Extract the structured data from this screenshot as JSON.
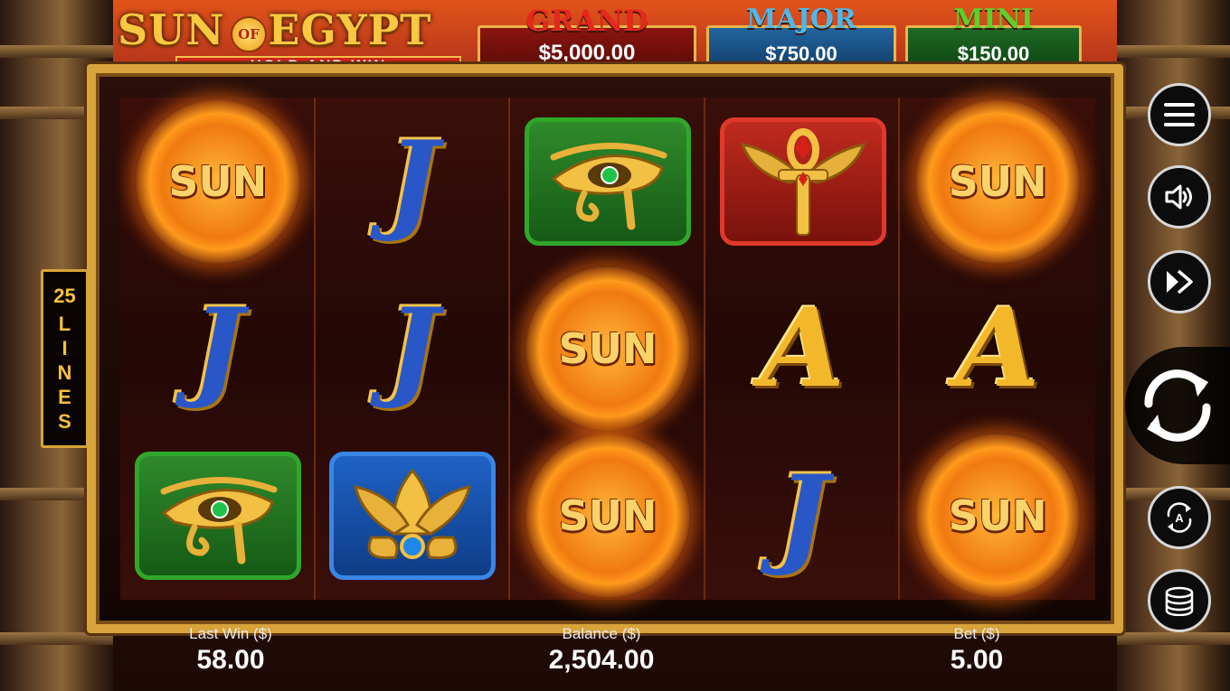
{
  "game": {
    "title": "SUN OF EGYPT",
    "title_main": "SUN",
    "title_of": "OF",
    "title_egypt": "EGYPT",
    "subtitle": "HOLD AND WIN"
  },
  "jackpots": [
    {
      "label": "GRAND",
      "value": "$5,000.00",
      "color": "#e6281c"
    },
    {
      "label": "MAJOR",
      "value": "$750.00",
      "color": "#52b7e6"
    },
    {
      "label": "MINI",
      "value": "$150.00",
      "color": "#5fd02a"
    }
  ],
  "paylines": {
    "count": "25",
    "word": "LINES"
  },
  "reels": [
    [
      "sun",
      "j",
      "eye"
    ],
    [
      "j",
      "j",
      "lotus"
    ],
    [
      "eye",
      "sun",
      "sun"
    ],
    [
      "ankh",
      "a",
      "j"
    ],
    [
      "sun",
      "a",
      "sun"
    ]
  ],
  "symbol_text": {
    "sun": "SUN",
    "j": "J",
    "a": "A"
  },
  "side_buttons": [
    "menu-icon",
    "sound-icon",
    "fast-forward-icon",
    "spin-icon",
    "autoplay-icon",
    "coins-icon"
  ],
  "autoplay_glyph": "A",
  "stats": {
    "last_win_label": "Last Win ($)",
    "last_win": "58.00",
    "balance_label": "Balance ($)",
    "balance": "2,504.00",
    "bet_label": "Bet ($)",
    "bet": "5.00"
  }
}
